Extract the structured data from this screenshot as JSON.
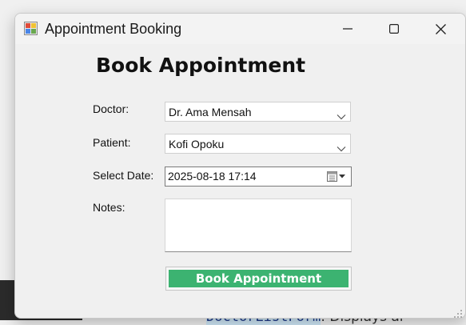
{
  "window": {
    "title": "Appointment Booking",
    "minimize_icon": "minimize-icon",
    "maximize_icon": "maximize-icon",
    "close_icon": "close-icon"
  },
  "form": {
    "heading": "Book Appointment",
    "doctor_label": "Doctor:",
    "doctor_value": "Dr. Ama Mensah",
    "patient_label": "Patient:",
    "patient_value": "Kofi Opoku",
    "date_label": "Select Date:",
    "date_value": "2025-08-18 17:14",
    "notes_label": "Notes:",
    "notes_value": "",
    "submit_label": "Book Appointment"
  },
  "background": {
    "code_highlight": "DoctorListForm",
    "code_rest": ": Displays al",
    "right_char": "r"
  },
  "colors": {
    "submit_button": "#3cb371",
    "window_bg": "#f0f0f0"
  }
}
